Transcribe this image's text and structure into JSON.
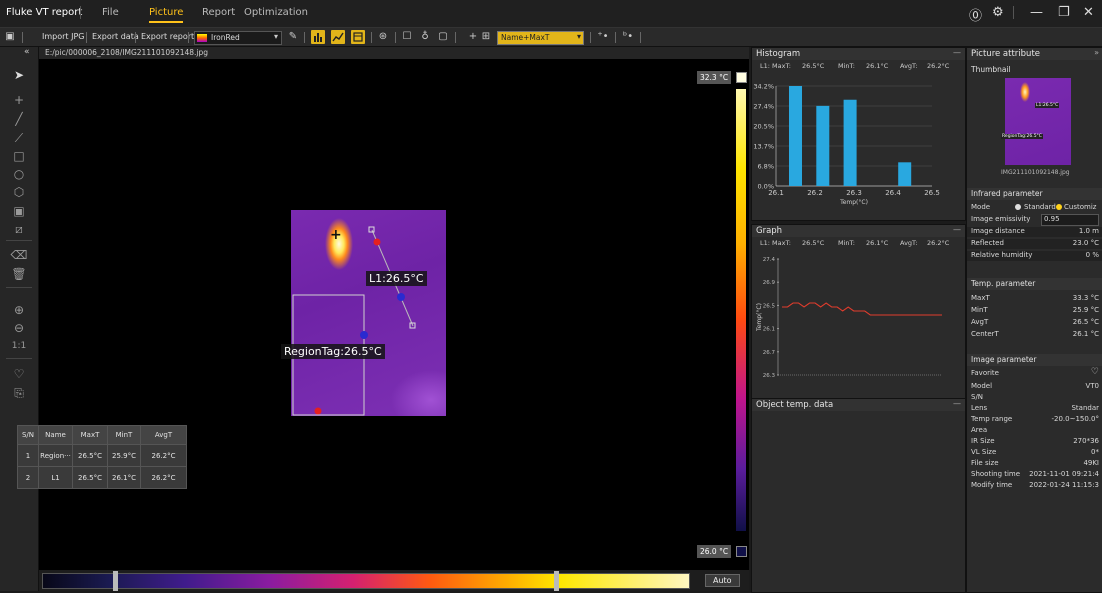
{
  "app": {
    "title": "Fluke VT report"
  },
  "menu": [
    "File",
    "Picture",
    "Report",
    "Optimization"
  ],
  "toolbar": {
    "import": "Import JPG",
    "export_data": "Export data",
    "export_report": "Export report",
    "palette": "IronRed",
    "label_mode": "Name+MaxT"
  },
  "filepath": "E:/pic/000006_2108/IMG211101092148.jpg",
  "image": {
    "line_label": "L1:26.5°C",
    "region_label": "RegionTag:26.5°C",
    "scale_max": "32.3 °C",
    "scale_min": "26.0 °C",
    "auto_label": "Auto"
  },
  "histogram": {
    "title": "Histogram",
    "stats": {
      "max_label": "L1: MaxT:",
      "max": "26.5°C",
      "min_label": "MinT:",
      "min": "26.1°C",
      "avg_label": "AvgT:",
      "avg": "26.2°C"
    }
  },
  "graph": {
    "title": "Graph",
    "stats": {
      "max_label": "L1: MaxT:",
      "max": "26.5°C",
      "min_label": "MinT:",
      "min": "26.1°C",
      "avg_label": "AvgT:",
      "avg": "26.2°C"
    }
  },
  "chart_data": [
    {
      "type": "bar",
      "xlabel": "Temp(°C)",
      "categories": [
        "26.1",
        "26.2",
        "26.3",
        "26.4",
        "26.5"
      ],
      "x": [
        26.15,
        26.22,
        26.29,
        26.36,
        26.43
      ],
      "values": [
        34.2,
        27.4,
        29.5,
        0,
        8.1
      ],
      "yticks": [
        "0.0%",
        "6.8%",
        "13.7%",
        "20.5%",
        "27.4%",
        "34.2%"
      ],
      "ylim": [
        0,
        34.2
      ],
      "xlim": [
        26.1,
        26.5
      ],
      "color": "#29a8e0"
    },
    {
      "type": "line",
      "ylabel": "Temp(°C)",
      "yticks": [
        "26.3",
        "26.7",
        "26.1",
        "26.5",
        "26.9",
        "27.4"
      ],
      "y": [
        26.4,
        26.4,
        26.5,
        26.5,
        26.4,
        26.5,
        26.5,
        26.4,
        26.5,
        26.4,
        26.4,
        26.3,
        26.4,
        26.3,
        26.3,
        26.3,
        26.2,
        26.2,
        26.2,
        26.2,
        26.2,
        26.2,
        26.2,
        26.2,
        26.2,
        26.2,
        26.2,
        26.2,
        26.2,
        26.2
      ],
      "color": "#e03c2c"
    }
  ],
  "object_temp": {
    "title": "Object temp. data",
    "headers": [
      "S/N",
      "Name",
      "MaxT",
      "MinT",
      "AvgT"
    ],
    "rows": [
      [
        "1",
        "Region···",
        "26.5°C",
        "25.9°C",
        "26.2°C"
      ],
      [
        "2",
        "L1",
        "26.5°C",
        "26.1°C",
        "26.2°C"
      ]
    ]
  },
  "attributes": {
    "title": "Picture attribute",
    "thumbnail_label": "Thumbnail",
    "thumb_file": "IMG211101092148.jpg",
    "thumb_line": "L1:26.5°C",
    "thumb_region": "RegionTag:26.5°C",
    "infrared": {
      "title": "Infrared parameter",
      "mode_label": "Mode",
      "mode_standard": "Standard",
      "mode_custom": "Customiz",
      "rows": [
        {
          "k": "Image emissivity",
          "v": "0.95"
        },
        {
          "k": "Image distance",
          "v": "1.0 m"
        },
        {
          "k": "Reflected",
          "v": "23.0 °C"
        },
        {
          "k": "Relative humidity",
          "v": "0 %"
        }
      ]
    },
    "temp": {
      "title": "Temp. parameter",
      "rows": [
        {
          "k": "MaxT",
          "v": "33.3 °C"
        },
        {
          "k": "MinT",
          "v": "25.9 °C"
        },
        {
          "k": "AvgT",
          "v": "26.5 °C"
        },
        {
          "k": "CenterT",
          "v": "26.1 °C"
        }
      ]
    },
    "image": {
      "title": "Image parameter",
      "rows": [
        {
          "k": "Favorite",
          "v": "♡"
        },
        {
          "k": "Model",
          "v": "VT0"
        },
        {
          "k": "S/N",
          "v": ""
        },
        {
          "k": "Lens",
          "v": "Standar"
        },
        {
          "k": "Temp range",
          "v": "-20.0~150.0°"
        },
        {
          "k": "Area",
          "v": ""
        },
        {
          "k": "IR Size",
          "v": "270*36"
        },
        {
          "k": "VL Size",
          "v": "0*"
        },
        {
          "k": "File size",
          "v": "49KI"
        },
        {
          "k": "Shooting time",
          "v": "2021-11-01 09:21:4"
        },
        {
          "k": "Modify time",
          "v": "2022-01-24 11:15:3"
        }
      ]
    }
  }
}
